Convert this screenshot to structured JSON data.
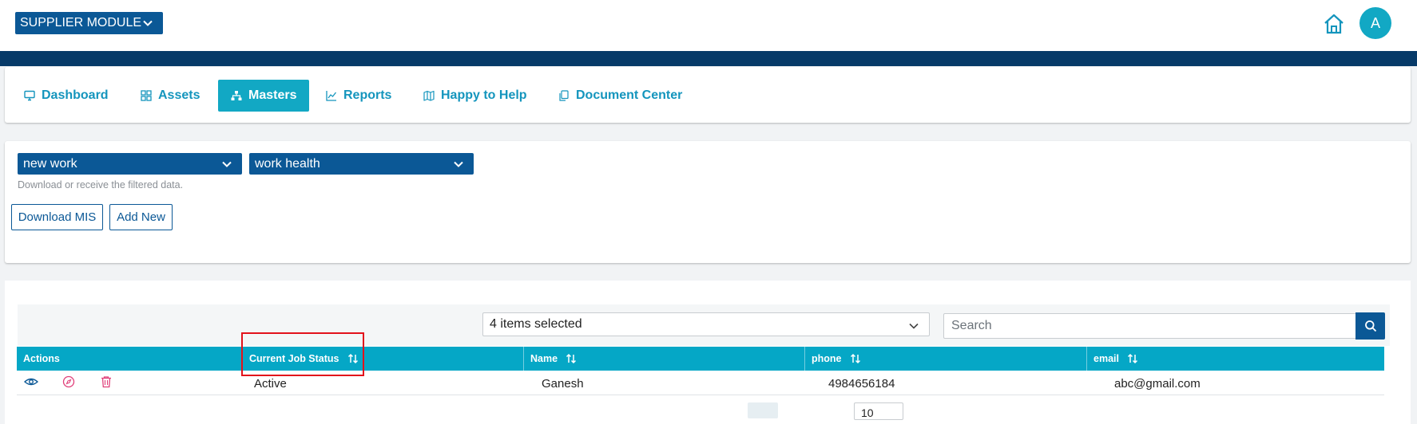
{
  "header": {
    "module_label": "SUPPLIER MODULE",
    "avatar_initial": "A"
  },
  "nav": {
    "tabs": [
      {
        "label": "Dashboard",
        "icon": "monitor-icon",
        "active": false
      },
      {
        "label": "Assets",
        "icon": "grid-icon",
        "active": false
      },
      {
        "label": "Masters",
        "icon": "sitemap-icon",
        "active": true
      },
      {
        "label": "Reports",
        "icon": "chart-line-icon",
        "active": false
      },
      {
        "label": "Happy to Help",
        "icon": "map-icon",
        "active": false
      },
      {
        "label": "Document Center",
        "icon": "copy-icon",
        "active": false
      }
    ]
  },
  "filters": {
    "select1": "new work",
    "select2": "work health",
    "hint": "Download or receive the filtered data.",
    "download_label": "Download MIS",
    "add_label": "Add New"
  },
  "table": {
    "column_select": "4 items selected",
    "search_placeholder": "Search",
    "columns": [
      "Actions",
      "Current Job Status",
      "Name",
      "phone",
      "email"
    ],
    "rows": [
      {
        "status": "Active",
        "name": "Ganesh",
        "phone": "4984656184",
        "email": "abc@gmail.com"
      }
    ],
    "page_size": "10"
  },
  "colors": {
    "brand_dark": "#0b5896",
    "band": "#073a68",
    "accent": "#12a8c4",
    "table_header": "#05a7c6",
    "action_icon": "#e0407a",
    "highlight": "#e3121b"
  }
}
